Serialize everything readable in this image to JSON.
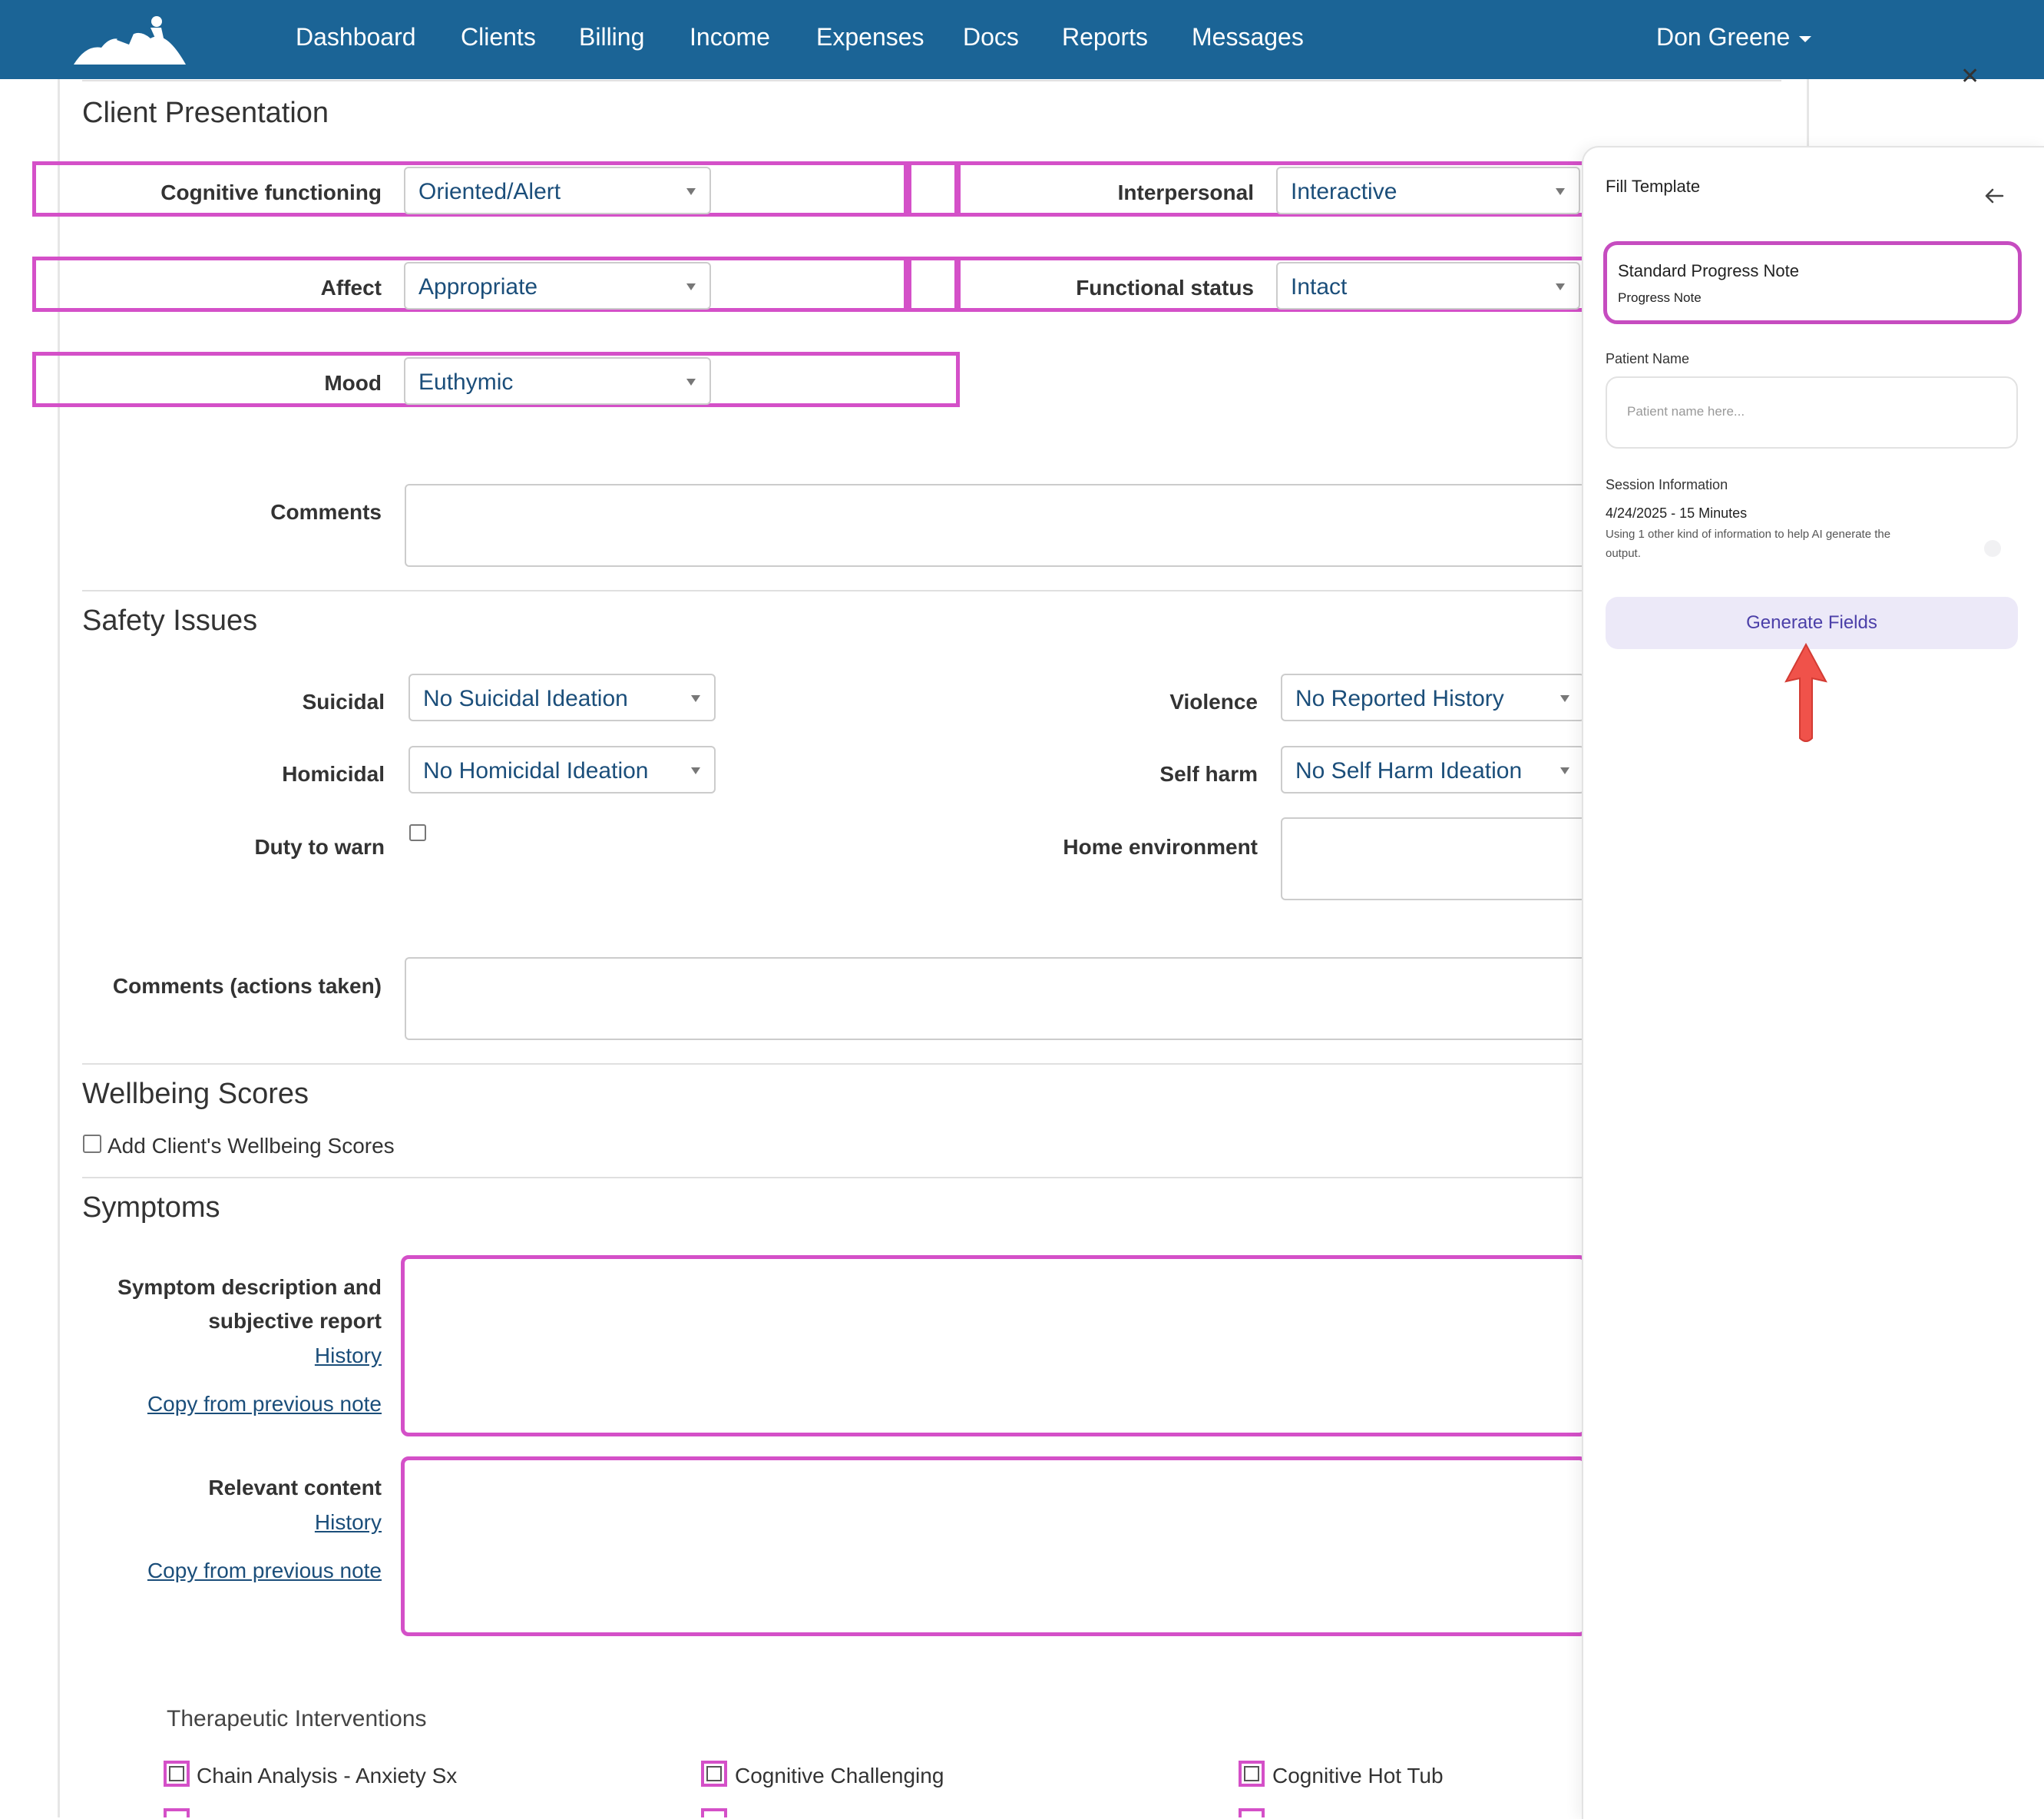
{
  "nav": {
    "items": [
      "Dashboard",
      "Clients",
      "Billing",
      "Income",
      "Expenses",
      "Docs",
      "Reports",
      "Messages"
    ],
    "user": "Don Greene"
  },
  "client_presentation": {
    "title": "Client Presentation",
    "cognitive": {
      "label": "Cognitive functioning",
      "value": "Oriented/Alert"
    },
    "interpersonal": {
      "label": "Interpersonal",
      "value": "Interactive"
    },
    "affect": {
      "label": "Affect",
      "value": "Appropriate"
    },
    "functional": {
      "label": "Functional status",
      "value": "Intact"
    },
    "mood": {
      "label": "Mood",
      "value": "Euthymic"
    },
    "comments_label": "Comments"
  },
  "safety": {
    "title": "Safety Issues",
    "suicidal": {
      "label": "Suicidal",
      "value": "No Suicidal Ideation"
    },
    "violence": {
      "label": "Violence",
      "value": "No Reported History"
    },
    "homicidal": {
      "label": "Homicidal",
      "value": "No Homicidal Ideation"
    },
    "selfharm": {
      "label": "Self harm",
      "value": "No Self Harm Ideation"
    },
    "duty_label": "Duty to warn",
    "home_label": "Home environment",
    "comments_label": "Comments (actions taken)"
  },
  "wellbeing": {
    "title": "Wellbeing Scores",
    "checkbox_label": "Add Client's Wellbeing Scores"
  },
  "symptoms": {
    "title": "Symptoms",
    "description_label_line1": "Symptom description and",
    "description_label_line2": "subjective report",
    "history_link": "History",
    "copy_link": "Copy from previous note",
    "relevant_label": "Relevant content"
  },
  "interventions": {
    "title": "Therapeutic Interventions",
    "items": [
      "Chain Analysis - Anxiety Sx",
      "Cognitive Challenging",
      "Cognitive Hot Tub"
    ]
  },
  "panel": {
    "title": "Fill Template",
    "template_name": "Standard Progress Note",
    "template_type": "Progress Note",
    "patient_label": "Patient Name",
    "patient_placeholder": "Patient name here...",
    "session_label": "Session Information",
    "session_value": "4/24/2025 - 15 Minutes",
    "session_note_line1": "Using 1 other kind of information to help AI generate the",
    "session_note_line2": "output.",
    "generate_button": "Generate Fields"
  },
  "colors": {
    "nav_bg": "#1b6496",
    "highlight": "#d450c8",
    "select_text": "#1b4e7a",
    "generate_bg": "#ece9f8",
    "generate_text": "#4b3fa8",
    "arrow": "#f0524a"
  },
  "icons": [
    "logo-icon",
    "chevron-down-icon",
    "close-icon",
    "back-arrow-icon",
    "red-arrow-icon"
  ]
}
